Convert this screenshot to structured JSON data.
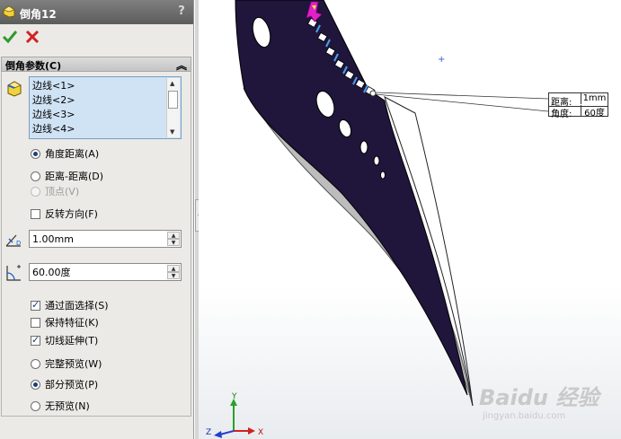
{
  "panel": {
    "title": "倒角12",
    "help": "?",
    "group_title": "倒角参数(C)",
    "edges": [
      "边线<1>",
      "边线<2>",
      "边线<3>",
      "边线<4>"
    ],
    "type_options": [
      {
        "label": "角度距离(A)",
        "selected": true,
        "enabled": true
      },
      {
        "label": "距离-距离(D)",
        "selected": false,
        "enabled": true
      },
      {
        "label": "顶点(V)",
        "selected": false,
        "enabled": false
      }
    ],
    "flip_direction": {
      "label": "反转方向(F)",
      "checked": false
    },
    "distance_value": "1.00mm",
    "angle_value": "60.00度",
    "checks": [
      {
        "label": "通过面选择(S)",
        "checked": true
      },
      {
        "label": "保持特征(K)",
        "checked": false
      },
      {
        "label": "切线延伸(T)",
        "checked": true
      }
    ],
    "preview_options": [
      {
        "label": "完整预览(W)",
        "selected": false
      },
      {
        "label": "部分预览(P)",
        "selected": true
      },
      {
        "label": "无预览(N)",
        "selected": false
      }
    ]
  },
  "callout": {
    "distance_label": "距离:",
    "distance_value": "1mm",
    "angle_label": "角度:",
    "angle_value": "60度"
  },
  "triad": {
    "x": "X",
    "y": "Y",
    "z": "Z"
  },
  "watermark": {
    "brand": "Baidu 经验",
    "url": "jingyan.baidu.com"
  },
  "colors": {
    "blade_dark": "#20153b",
    "chamfer_pink": "#e020c8",
    "edge_highlight": "#4aa0e8"
  }
}
